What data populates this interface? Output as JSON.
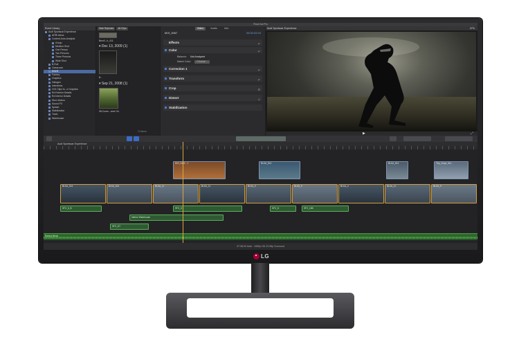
{
  "app": {
    "window_title": "Final Cut Pro"
  },
  "library": {
    "header": "Event Library",
    "items": [
      "Audi Sportscar Experience",
      "ARRI Alexa",
      "Content Auto-Analysis",
      "Group",
      "Medium Shot",
      "One Person",
      "Two Persons",
      "Three Persons",
      "Wide Shot",
      "B-Roll",
      "Classroom",
      "DSLR",
      "Factory",
      "Graphics",
      "Halogen",
      "Interviews",
      "OrG Clips fo...e Graphics",
      "Rd Exterior Details",
      "Rd Interior Details",
      "Sbox Motion",
      "Sound FX",
      "Splash",
      "Stabilization",
      "Track",
      "Warehouse"
    ],
    "selected_index": 11
  },
  "browser": {
    "filter_label": "All Clips",
    "hide_rejected": "Hide Rejected",
    "clip1_label": "Bmx0...ir_411",
    "date1": "Dec 13, 2009  (1)",
    "clip2_label": "B...",
    "date2": "Sep 21, 2008  (1)",
    "clip3_label": "08-Come...ome On",
    "footer": "13 items"
  },
  "inspector": {
    "tabs": [
      "Video",
      "Audio",
      "Info"
    ],
    "active_tab": 0,
    "clip_name": "MVI_0067",
    "timecode": "00:00:02:04",
    "sections": [
      "Effects",
      "Color",
      "Correction 1",
      "Transform",
      "Crop",
      "Distort",
      "Stabilization"
    ],
    "balance_label": "Balance:",
    "balance_value": "Not Analyzed",
    "match_label": "Match Color:",
    "match_button": "Choose..."
  },
  "viewer": {
    "title": "Audi Sportscar Experience",
    "zoom": "47%"
  },
  "timeline": {
    "title": "Audi Sportscar Experience",
    "connected_clips": [
      {
        "label": "MVI_0432 - J"
      },
      {
        "label": "BLKA_814"
      },
      {
        "label": "BLKA_814"
      },
      {
        "label": "Tiny_Dope_Sel..."
      }
    ],
    "storyline_clips": [
      "BLKA_014",
      "BLKA_814",
      "BLKA_11",
      "BLKA_11",
      "BLKA_9",
      "BLKA_9",
      "BLKA_4",
      "BLKA_11",
      "BLKA_9"
    ],
    "audio_clips": [
      {
        "label": "SFX_5_B"
      },
      {
        "label": "SFX_D"
      },
      {
        "label": "SFX_D"
      },
      {
        "label": "SFX_10B"
      },
      {
        "label": "Interior Warehouse"
      },
      {
        "label": "SFX_D7"
      }
    ],
    "music_label": "Racing Music",
    "status": "37:38:03 total - 1080p HD 23.98p Surround"
  },
  "brand": {
    "logo_text": "LG"
  }
}
